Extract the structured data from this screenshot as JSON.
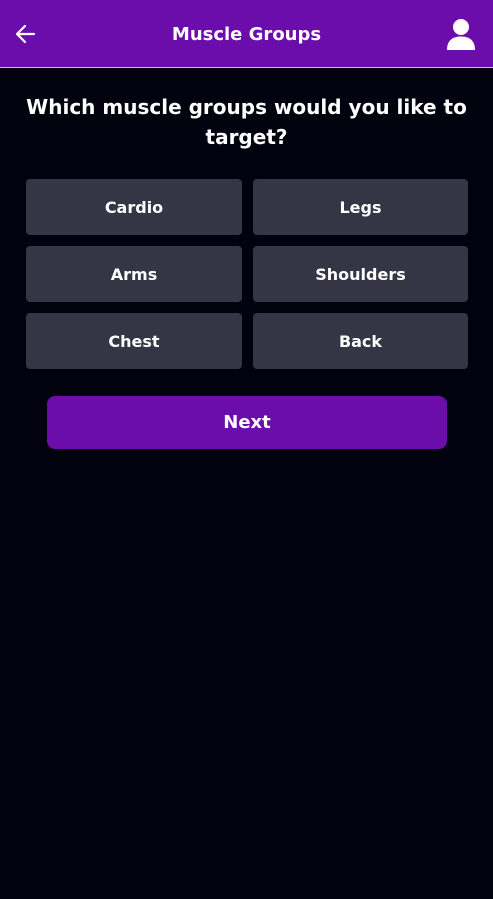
{
  "header": {
    "title": "Muscle Groups",
    "back_icon": "arrow-left-icon",
    "profile_icon": "user-icon"
  },
  "question": "Which muscle groups would you like to target?",
  "options": [
    {
      "label": "Cardio"
    },
    {
      "label": "Legs"
    },
    {
      "label": "Arms"
    },
    {
      "label": "Shoulders"
    },
    {
      "label": "Chest"
    },
    {
      "label": "Back"
    }
  ],
  "next_label": "Next",
  "colors": {
    "accent": "#6a0dab",
    "background": "#02020f",
    "option_bg": "#353545",
    "text": "#ffffff"
  }
}
